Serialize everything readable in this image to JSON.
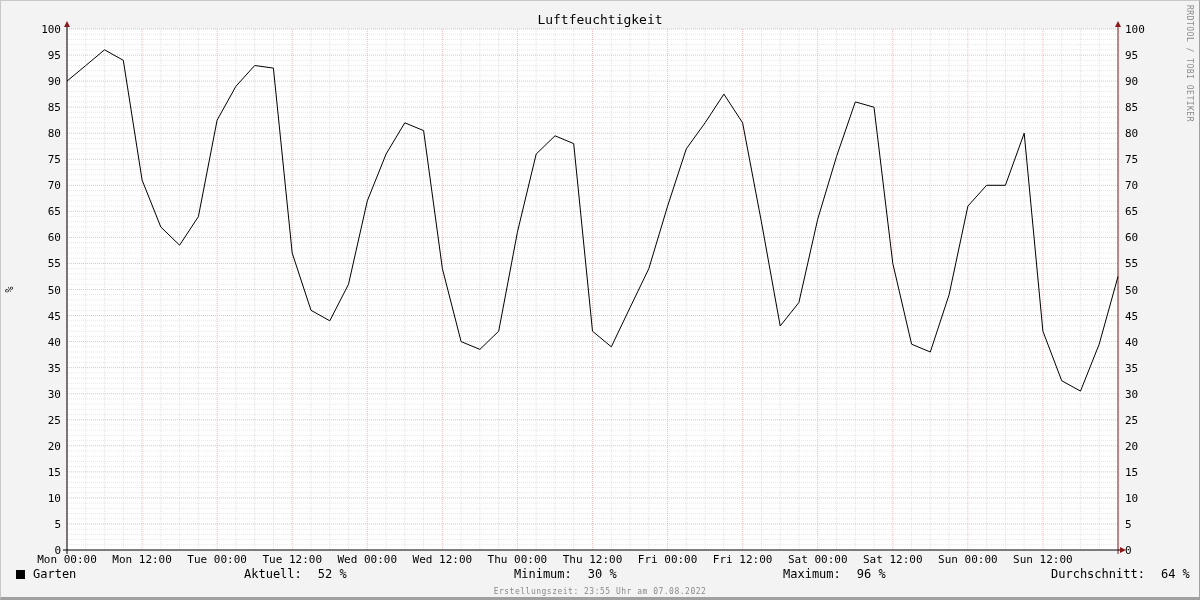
{
  "chart": {
    "chart_data": {
      "type": "line",
      "title": "Luftfeuchtigkeit",
      "ylabel": "%",
      "grid": true,
      "ylim": [
        0,
        100
      ],
      "categories": [
        "Mon 00:00",
        null,
        null,
        null,
        "Mon 12:00",
        null,
        null,
        null,
        "Tue 00:00",
        null,
        null,
        null,
        "Tue 12:00",
        null,
        null,
        null,
        "Wed 00:00",
        null,
        null,
        null,
        "Wed 12:00",
        null,
        null,
        null,
        "Thu 00:00",
        null,
        null,
        null,
        "Thu 12:00",
        null,
        null,
        null,
        "Fri 00:00",
        null,
        null,
        null,
        "Fri 12:00",
        null,
        null,
        null,
        "Sat 00:00",
        null,
        null,
        null,
        "Sat 12:00",
        null,
        null,
        null,
        "Sun 00:00",
        null,
        null,
        null,
        "Sun 12:00",
        null,
        null,
        null,
        null
      ],
      "yticks": [
        0,
        5,
        10,
        15,
        20,
        25,
        30,
        35,
        40,
        45,
        50,
        55,
        60,
        65,
        70,
        75,
        80,
        85,
        90,
        95,
        100
      ],
      "series": [
        {
          "name": "Garten",
          "color": "#000000",
          "values": [
            90,
            93,
            96,
            94,
            71,
            62,
            58.5,
            64,
            82.5,
            89,
            93,
            92.5,
            57,
            46,
            44,
            51,
            67,
            76,
            82,
            80.5,
            54,
            40,
            38.5,
            42,
            61,
            76,
            79.5,
            78,
            42,
            39,
            46.5,
            54,
            66,
            77,
            82,
            87.5,
            82,
            63,
            43,
            47.5,
            63.5,
            75.5,
            86,
            85,
            55,
            39.5,
            38,
            49,
            66,
            70,
            70,
            80,
            42,
            32.5,
            30.5,
            39.5,
            52.5
          ]
        }
      ]
    },
    "right_axis_labels": [
      "100",
      "95",
      "90",
      "85",
      "80",
      "75",
      "70",
      "65",
      "60",
      "55",
      "50",
      "45",
      "40",
      "35",
      "30",
      "25",
      "20",
      "15",
      "10",
      "5",
      "0"
    ]
  },
  "legend": {
    "stats": [
      {
        "label": "Aktuell:",
        "value": "52 %"
      },
      {
        "label": "Minimum:",
        "value": "30 %"
      },
      {
        "label": "Maximum:",
        "value": "96 %"
      },
      {
        "label": "Durchschnitt:",
        "value": "64 %"
      }
    ]
  },
  "footer": "Erstellungszeit: 23:55 Uhr am 07.08.2022",
  "credit": "RRDTOOL / TOBI OETIKER"
}
